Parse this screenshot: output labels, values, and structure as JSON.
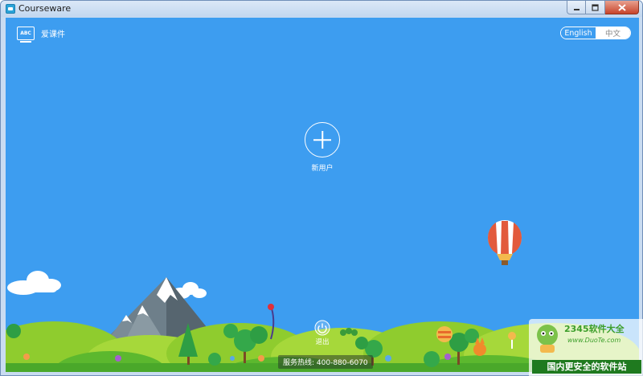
{
  "window": {
    "title": "Courseware"
  },
  "app": {
    "logo_text": "ABC",
    "name": "爱课件"
  },
  "language": {
    "options": [
      "English",
      "中文"
    ],
    "selected": "English"
  },
  "main": {
    "new_user_label": "新用户"
  },
  "footer": {
    "exit_label": "退出",
    "hotline": "服务热线: 400-880-6070"
  },
  "watermark": {
    "brand": "2345软件大全",
    "url": "www.DuoTe.com",
    "slogan": "国内更安全的软件站"
  },
  "colors": {
    "background": "#3d9df0",
    "grass": "#8ac926",
    "dark_grass": "#4caf50"
  }
}
